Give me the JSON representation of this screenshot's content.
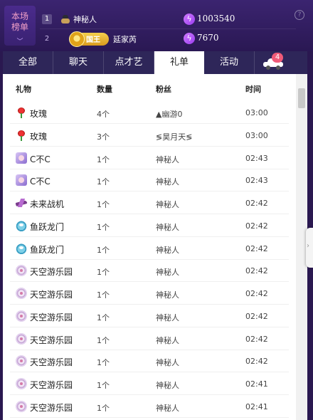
{
  "ranking": {
    "toggle_line1": "本场",
    "toggle_line2": "榜单",
    "toggle_icon": "chevron-down-icon",
    "rows": [
      {
        "rank": "1",
        "name": "神秘人",
        "icon": "mystery-hat-icon",
        "score": "1003540"
      },
      {
        "rank": "2",
        "badge": "国王",
        "name": "延家芮",
        "score": "7670"
      }
    ],
    "help_icon": "?"
  },
  "tabs": [
    {
      "label": "全部",
      "active": false
    },
    {
      "label": "聊天",
      "active": false
    },
    {
      "label": "点才艺",
      "active": false
    },
    {
      "label": "礼单",
      "active": true
    },
    {
      "label": "活动",
      "active": false
    },
    {
      "icon": "car-icon",
      "badge": "4",
      "active": false
    }
  ],
  "table": {
    "headers": {
      "gift": "礼物",
      "qty": "数量",
      "fan": "粉丝",
      "time": "时间"
    },
    "rows": [
      {
        "gift": "玫瑰",
        "icon": "rose",
        "qty": "4个",
        "fan": "▲幽游0",
        "time": "03:00"
      },
      {
        "gift": "玫瑰",
        "icon": "rose",
        "qty": "3个",
        "fan": "≶昊月天≶",
        "time": "03:00"
      },
      {
        "gift": "C不C",
        "icon": "cbc",
        "qty": "1个",
        "fan": "神秘人",
        "time": "02:43"
      },
      {
        "gift": "C不C",
        "icon": "cbc",
        "qty": "1个",
        "fan": "神秘人",
        "time": "02:43"
      },
      {
        "gift": "未来战机",
        "icon": "jet",
        "qty": "1个",
        "fan": "神秘人",
        "time": "02:42"
      },
      {
        "gift": "鱼跃龙门",
        "icon": "fish",
        "qty": "1个",
        "fan": "神秘人",
        "time": "02:42"
      },
      {
        "gift": "鱼跃龙门",
        "icon": "fish",
        "qty": "1个",
        "fan": "神秘人",
        "time": "02:42"
      },
      {
        "gift": "天空游乐园",
        "icon": "park",
        "qty": "1个",
        "fan": "神秘人",
        "time": "02:42"
      },
      {
        "gift": "天空游乐园",
        "icon": "park",
        "qty": "1个",
        "fan": "神秘人",
        "time": "02:42"
      },
      {
        "gift": "天空游乐园",
        "icon": "park",
        "qty": "1个",
        "fan": "神秘人",
        "time": "02:42"
      },
      {
        "gift": "天空游乐园",
        "icon": "park",
        "qty": "1个",
        "fan": "神秘人",
        "time": "02:42"
      },
      {
        "gift": "天空游乐园",
        "icon": "park",
        "qty": "1个",
        "fan": "神秘人",
        "time": "02:42"
      },
      {
        "gift": "天空游乐园",
        "icon": "park",
        "qty": "1个",
        "fan": "神秘人",
        "time": "02:41"
      },
      {
        "gift": "天空游乐园",
        "icon": "park",
        "qty": "1个",
        "fan": "神秘人",
        "time": "02:41"
      }
    ]
  },
  "side_handle_icon": "chevron-right-icon"
}
